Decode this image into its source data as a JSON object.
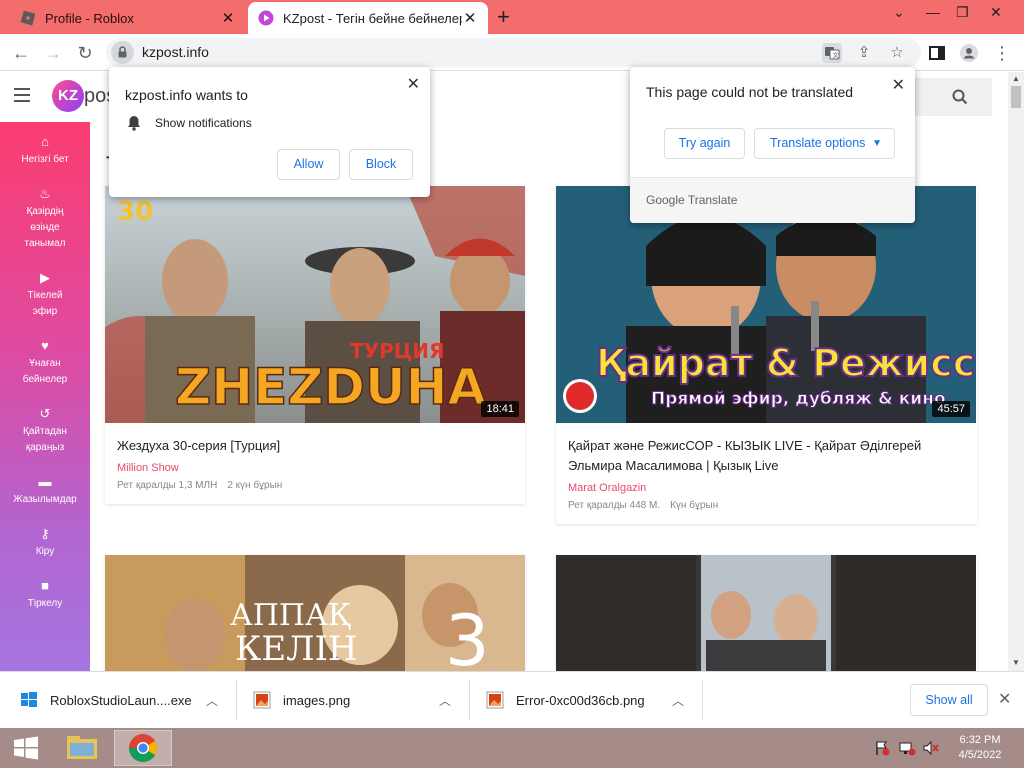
{
  "browser": {
    "tabs": [
      {
        "title": "Profile - Roblox",
        "active": false
      },
      {
        "title": "KZpost - Тегін бейне бейнелерді",
        "active": true
      }
    ],
    "address": "kzpost.info"
  },
  "permission_prompt": {
    "title": "kzpost.info wants to",
    "permission": "Show notifications",
    "allow_label": "Allow",
    "block_label": "Block"
  },
  "translate_bubble": {
    "message": "This page could not be translated",
    "try_again_label": "Try again",
    "options_label": "Translate options",
    "brand_google": "Google",
    "brand_translate": "Translate"
  },
  "site": {
    "logo_mark": "KZ",
    "logo_text": "post",
    "section_title": "Т",
    "sidebar": [
      {
        "label": "Негізгі бет",
        "icon": "home-icon"
      },
      {
        "label": "Қазірдің өзінде танымал",
        "icon": "fire-icon"
      },
      {
        "label": "Тікелей эфир",
        "icon": "live-icon"
      },
      {
        "label": "Ұнаған бейнелер",
        "icon": "heart-icon"
      },
      {
        "label": "Қайтадан қараңыз",
        "icon": "history-icon"
      },
      {
        "label": "Жазылымдар",
        "icon": "folder-icon"
      },
      {
        "label": "Кіру",
        "icon": "key-icon"
      },
      {
        "label": "Тіркелу",
        "icon": "lock-icon"
      }
    ]
  },
  "videos": [
    {
      "title": "Жездуха 30-серия [Турция]",
      "channel": "Million Show",
      "views": "Рет қаралды 1,3 МЛН",
      "age": "2 күн бұрын",
      "duration": "18:41",
      "thumb_number": "30",
      "thumb_title": "ZHEZDUHA",
      "thumb_subtitle": "ТУРЦИЯ"
    },
    {
      "title": "Қайрат және РежисСОР - КЫЗЫК LIVE - Қайрат Әділгерей Эльмира Масалимова | Қызық Live",
      "channel": "Marat Oralgazin",
      "views": "Рет қаралды 448 М.",
      "age": "Күн бұрын",
      "duration": "45:57",
      "thumb_title": "Қайрат & Режиссӛр",
      "thumb_subtitle": "Прямой эфир, дубляж & кино"
    },
    {
      "thumb_title_line1": "АППАҚ",
      "thumb_title_line2": "КЕЛІН",
      "thumb_number": "3"
    },
    {}
  ],
  "downloads": [
    {
      "name": "RobloxStudioLaun....exe",
      "type": "exe"
    },
    {
      "name": "images.png",
      "type": "png"
    },
    {
      "name": "Error-0xc00d36cb.png",
      "type": "png"
    }
  ],
  "downloads_show_all": "Show all",
  "taskbar": {
    "time": "6:32 PM",
    "date": "4/5/2022"
  },
  "colors": {
    "tabstrip": "#f26d6b",
    "accent_blue": "#1a73e8",
    "channel_pink": "#e84b6c",
    "taskbar": "#a68c89"
  }
}
